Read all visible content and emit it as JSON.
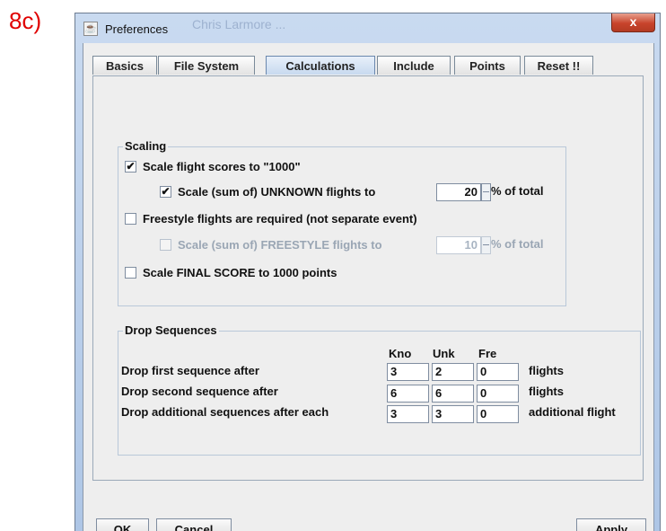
{
  "figure_label": "8c)",
  "window": {
    "title": "Preferences",
    "ghost_title": "Chris Larmore ...",
    "close_glyph": "x",
    "app_icon_glyph": "☕"
  },
  "tabs": [
    {
      "label": "Basics",
      "selected": false
    },
    {
      "label": "File System",
      "selected": false
    },
    {
      "label": "Calculations",
      "selected": true
    },
    {
      "label": "Include",
      "selected": false
    },
    {
      "label": "Points",
      "selected": false
    },
    {
      "label": "Reset !!",
      "selected": false
    }
  ],
  "scaling": {
    "title": "Scaling",
    "scale_flight_scores": {
      "label": "Scale flight scores to \"1000\"",
      "checked": true
    },
    "scale_unknown": {
      "label": "Scale (sum of) UNKNOWN flights to",
      "checked": true,
      "value": "20",
      "suffix": "% of total"
    },
    "freestyle_required": {
      "label": "Freestyle flights are required (not separate event)",
      "checked": false
    },
    "scale_freestyle": {
      "label": "Scale (sum of) FREESTYLE flights to",
      "checked": false,
      "value": "10",
      "suffix": "% of total",
      "disabled": true
    },
    "scale_final": {
      "label": "Scale FINAL SCORE to 1000 points",
      "checked": false
    }
  },
  "drop_sequences": {
    "title": "Drop Sequences",
    "columns": [
      "Kno",
      "Unk",
      "Fre"
    ],
    "rows": [
      {
        "label": "Drop first sequence after",
        "values": [
          "3",
          "2",
          "0"
        ],
        "suffix": "flights"
      },
      {
        "label": "Drop second sequence after",
        "values": [
          "6",
          "6",
          "0"
        ],
        "suffix": "flights"
      },
      {
        "label": "Drop additional sequences after each",
        "values": [
          "3",
          "3",
          "0"
        ],
        "suffix": "additional flight"
      }
    ]
  },
  "buttons": {
    "ok": "OK",
    "cancel": "Cancel",
    "apply": "Apply"
  },
  "check_glyph": "✔"
}
